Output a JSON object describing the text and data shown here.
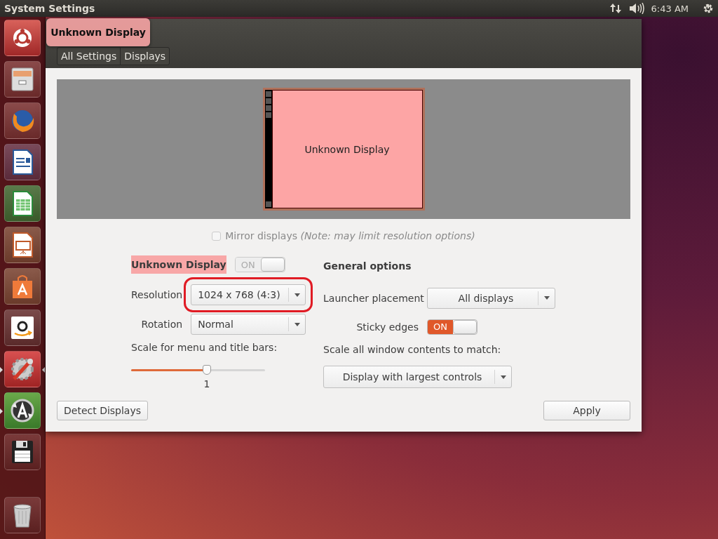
{
  "top_panel": {
    "title": "System Settings",
    "clock": "6:43 AM"
  },
  "launcher": {
    "items": [
      {
        "kind": "dash",
        "running": false,
        "focused": false
      },
      {
        "kind": "files",
        "running": false,
        "focused": false
      },
      {
        "kind": "browser",
        "running": false,
        "focused": false
      },
      {
        "kind": "writer",
        "running": false,
        "focused": false
      },
      {
        "kind": "calc",
        "running": false,
        "focused": false
      },
      {
        "kind": "impress",
        "running": false,
        "focused": false
      },
      {
        "kind": "store",
        "running": false,
        "focused": false
      },
      {
        "kind": "shop",
        "running": false,
        "focused": false
      },
      {
        "kind": "settings",
        "running": true,
        "focused": true
      },
      {
        "kind": "updater",
        "running": true,
        "focused": false
      },
      {
        "kind": "disk",
        "running": false,
        "focused": false
      },
      {
        "kind": "trash",
        "running": false,
        "focused": false
      }
    ]
  },
  "window": {
    "overlay_label": "Unknown Display",
    "breadcrumb": [
      "All Settings",
      "Displays"
    ]
  },
  "arrangement": {
    "monitor_label": "Unknown Display"
  },
  "mirror": {
    "label": "Mirror displays",
    "note": "(Note: may limit resolution options)",
    "checked": false,
    "disabled": true
  },
  "monitor": {
    "name": "Unknown Display",
    "switch": {
      "label": "ON",
      "on": true,
      "disabled": true
    },
    "resolution": {
      "label": "Resolution",
      "value": "1024 x 768 (4:3)",
      "highlighted": true
    },
    "rotation": {
      "label": "Rotation",
      "value": "Normal"
    },
    "scale": {
      "label": "Scale for menu and title bars:",
      "level": 0.565,
      "reading": "1"
    }
  },
  "general": {
    "heading": "General options",
    "launcher_placement": {
      "label": "Launcher placement",
      "value": "All displays"
    },
    "sticky_edges": {
      "label": "Sticky edges",
      "switch": {
        "label": "ON",
        "on": true,
        "disabled": false
      }
    },
    "scale_label": "Scale all window contents to match:",
    "scale_value": "Display with largest controls"
  },
  "buttons": {
    "detect": "Detect Displays",
    "apply": "Apply"
  }
}
